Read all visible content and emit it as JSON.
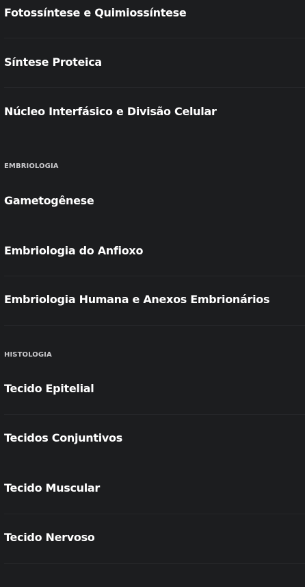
{
  "groups": [
    {
      "items": [
        {
          "label": "Fotossíntese e Quimiossíntese"
        },
        {
          "label": "Síntese Proteica"
        },
        {
          "label": "Núcleo Interfásico e Divisão Celular"
        }
      ]
    },
    {
      "title": "EMBRIOLOGIA",
      "items": [
        {
          "label": "Gametogênese"
        },
        {
          "label": "Embriologia do Anfioxo"
        },
        {
          "label": "Embriologia Humana e Anexos Embrionários"
        }
      ]
    },
    {
      "title": "HISTOLOGIA",
      "items": [
        {
          "label": "Tecido Epitelial"
        },
        {
          "label": "Tecidos Conjuntivos"
        },
        {
          "label": "Tecido Muscular"
        },
        {
          "label": "Tecido Nervoso"
        }
      ]
    }
  ]
}
